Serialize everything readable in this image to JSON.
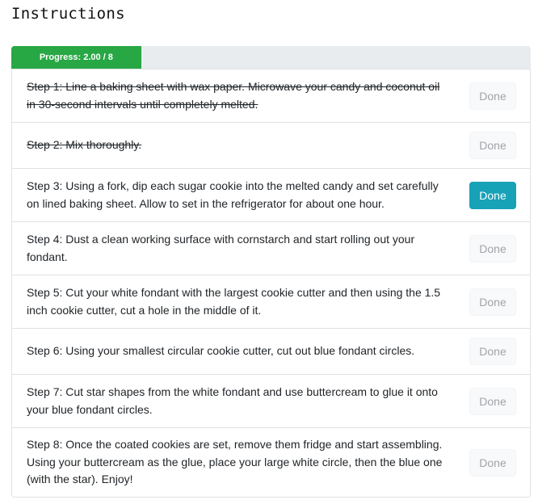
{
  "header": {
    "title": "Instructions"
  },
  "progress": {
    "label": "Progress: 2.00 / 8",
    "completed": 2,
    "total": 8,
    "bar_color": "#28a745",
    "track_color": "#e9ecef"
  },
  "steps": [
    {
      "text": "Step 1: Line a baking sheet with wax paper. Microwave your candy and coconut oil in 30-second intervals until completely melted.",
      "completed": true,
      "button_label": "Done",
      "button_active": false
    },
    {
      "text": "Step 2: Mix thoroughly.",
      "completed": true,
      "button_label": "Done",
      "button_active": false
    },
    {
      "text": "Step 3: Using a fork, dip each sugar cookie into the melted candy and set carefully on lined baking sheet. Allow to set in the refrigerator for about one hour.",
      "completed": false,
      "button_label": "Done",
      "button_active": true
    },
    {
      "text": "Step 4: Dust a clean working surface with cornstarch and start rolling out your fondant.",
      "completed": false,
      "button_label": "Done",
      "button_active": false
    },
    {
      "text": "Step 5: Cut your white fondant with the largest cookie cutter and then using the 1.5 inch cookie cutter, cut a hole in the middle of it.",
      "completed": false,
      "button_label": "Done",
      "button_active": false
    },
    {
      "text": "Step 6: Using your smallest circular cookie cutter, cut out blue fondant circles.",
      "completed": false,
      "button_label": "Done",
      "button_active": false
    },
    {
      "text": "Step 7: Cut star shapes from the white fondant and use buttercream to glue it onto your blue fondant circles.",
      "completed": false,
      "button_label": "Done",
      "button_active": false
    },
    {
      "text": "Step 8: Once the coated cookies are set, remove them fridge and start assembling. Using your buttercream as the glue, place your large white circle, then the blue one (with the star). Enjoy!",
      "completed": false,
      "button_label": "Done",
      "button_active": false
    }
  ],
  "colors": {
    "active_button": "#17a2b8",
    "inactive_button_text": "#a0a4a8"
  }
}
